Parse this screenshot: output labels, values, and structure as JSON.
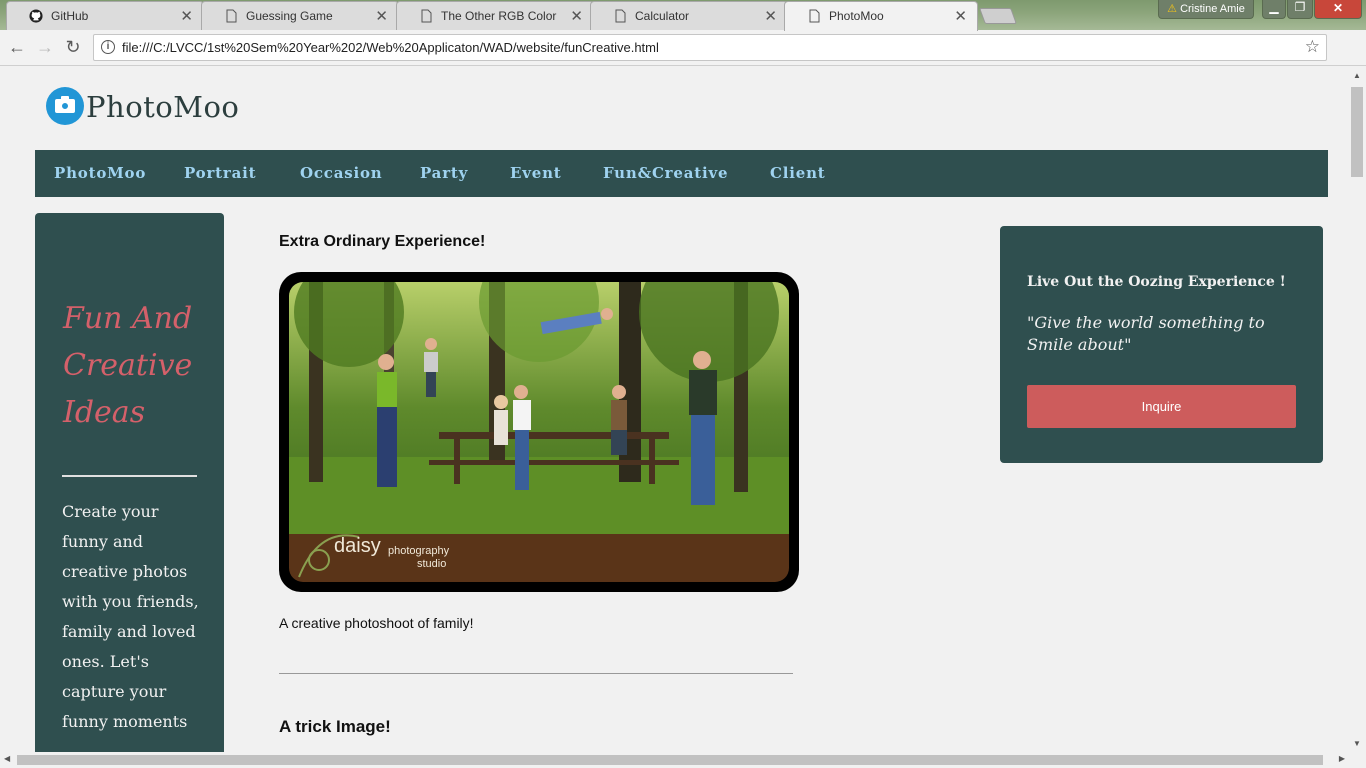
{
  "browser": {
    "tabs": [
      {
        "label": "GitHub",
        "icon": "github-icon"
      },
      {
        "label": "Guessing Game",
        "icon": "page-icon"
      },
      {
        "label": "The Other RGB Color Cha",
        "icon": "page-icon"
      },
      {
        "label": "Calculator",
        "icon": "page-icon"
      },
      {
        "label": "PhotoMoo",
        "icon": "page-icon"
      }
    ],
    "user": "Cristine Amie",
    "url": "file:///C:/LVCC/1st%20Sem%20Year%202/Web%20Applicaton/WAD/website/funCreative.html"
  },
  "site": {
    "logo_text": "PhotoMoo",
    "nav": [
      "PhotoMoo",
      "Portrait",
      "Occasion",
      "Party",
      "Event",
      "Fun&Creative",
      "Client"
    ]
  },
  "sidebar": {
    "headline": "Fun And Creative Ideas",
    "blurb": "Create your funny and creative photos with you friends, family and loved ones. Let's capture your funny moments"
  },
  "main": {
    "heading1": "Extra Ordinary Experience!",
    "photo_watermark_brand": "daisy",
    "photo_watermark_sub1": "photography",
    "photo_watermark_sub2": "studio",
    "caption": "A creative photoshoot of family!",
    "heading2": "A trick Image!"
  },
  "promo": {
    "title": "Live Out the Oozing Experience !",
    "quote": "\"Give the world something to Smile about\"",
    "button_label": "Inquire"
  },
  "colors": {
    "panel": "#2f4f4f",
    "nav_link": "#9fd3f0",
    "accent": "#cd5c5c",
    "headline": "#d4606a"
  }
}
